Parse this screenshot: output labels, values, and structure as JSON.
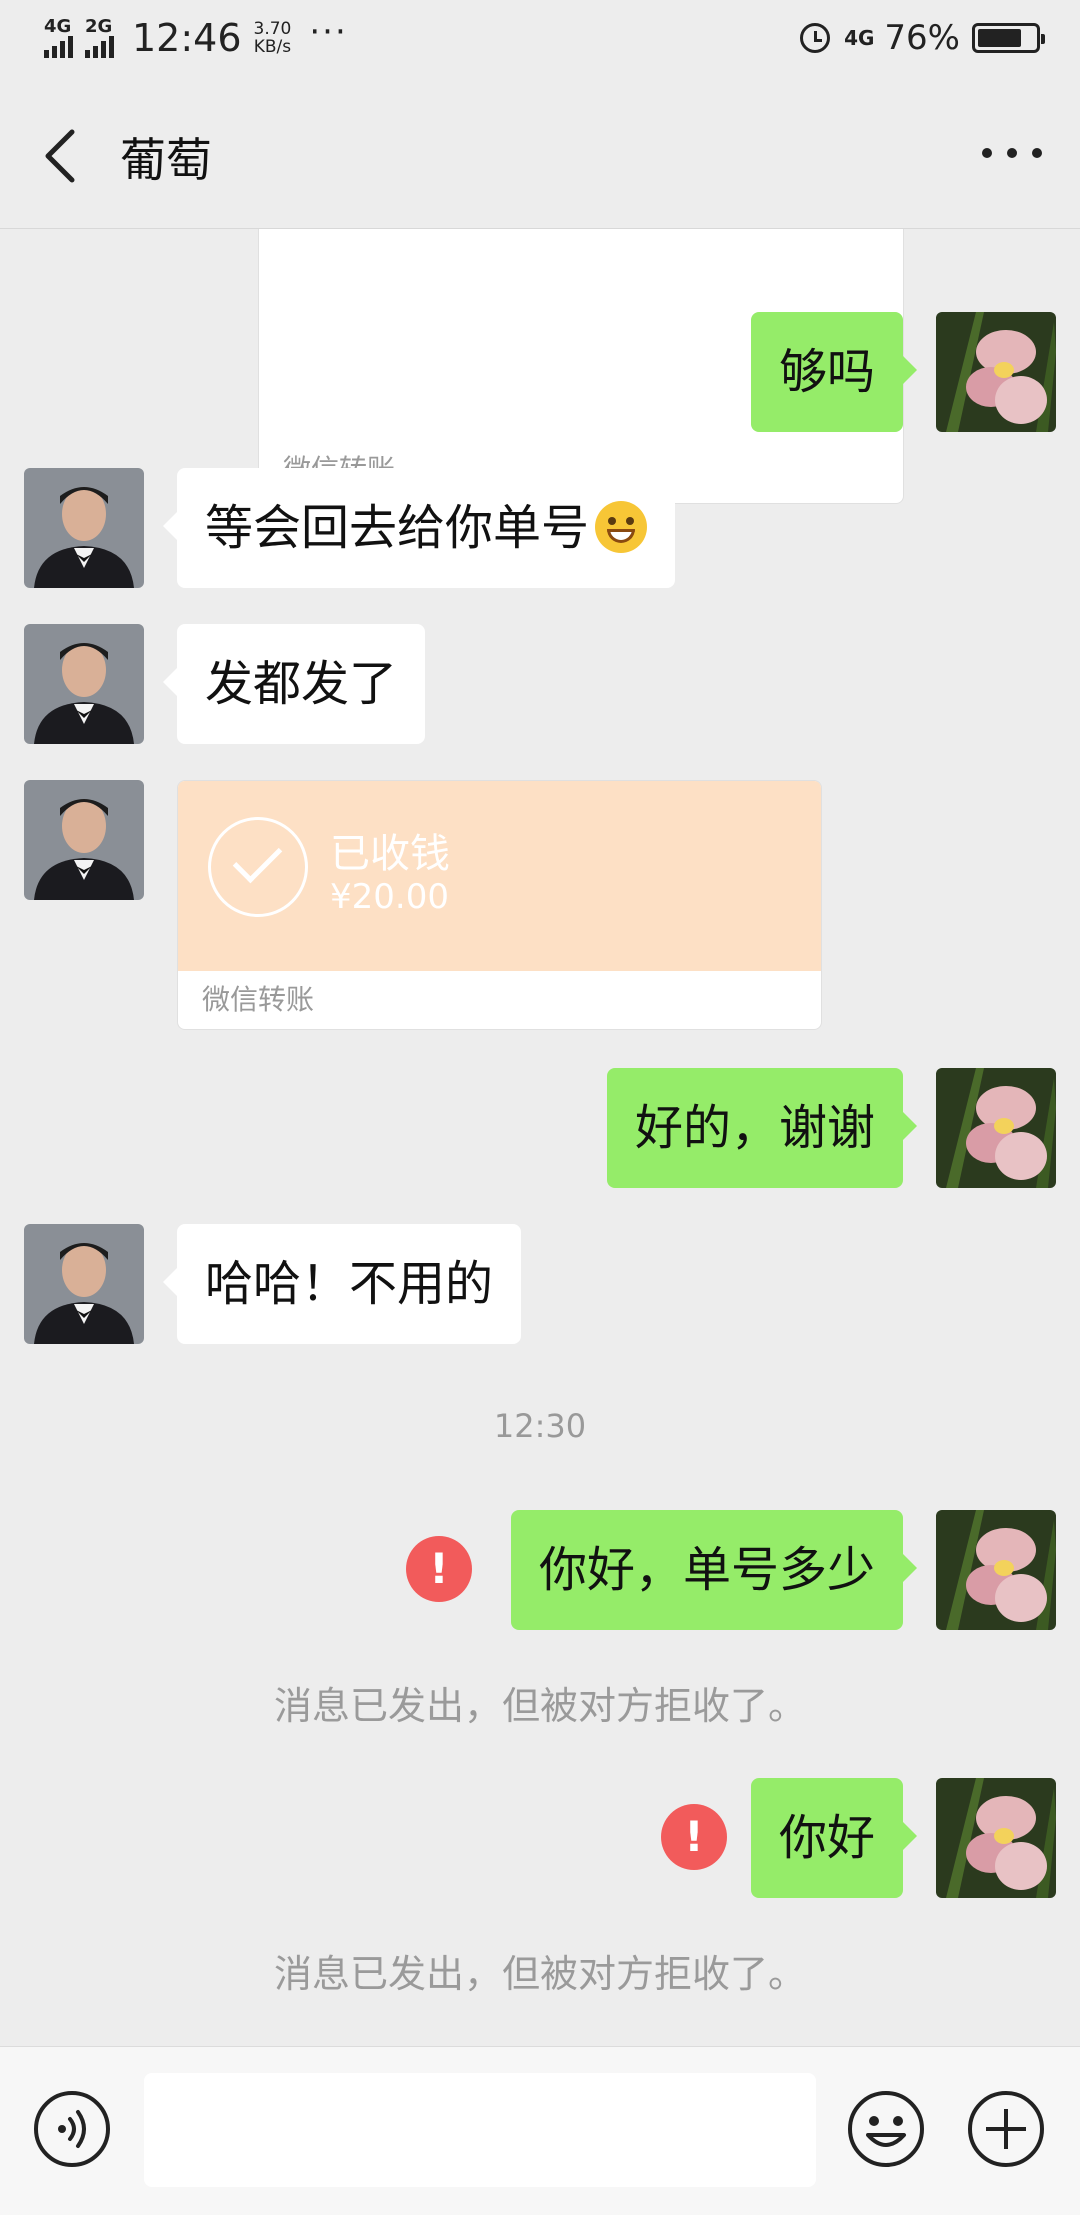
{
  "status_bar": {
    "signal1": "4G",
    "signal2": "2G",
    "time": "12:46",
    "net_speed_value": "3.70",
    "net_speed_unit": "KB/s",
    "dots": "···",
    "network": "4G",
    "battery": "76%",
    "battery_level": 0.76
  },
  "header": {
    "title": "葡萄"
  },
  "messages": [
    {
      "type": "transfer_footer_partial",
      "footer": "微信转账"
    },
    {
      "type": "text",
      "side": "right",
      "text": "够吗"
    },
    {
      "type": "text",
      "side": "left",
      "text": "等会回去给你单号",
      "emoji": "grin-emoji"
    },
    {
      "type": "text",
      "side": "left",
      "text": "发都发了"
    },
    {
      "type": "transfer",
      "side": "left",
      "title": "已收钱",
      "amount": "¥20.00",
      "footer": "微信转账"
    },
    {
      "type": "text",
      "side": "right",
      "text": "好的，谢谢"
    },
    {
      "type": "text",
      "side": "left",
      "text": "哈哈！不用的"
    },
    {
      "type": "time",
      "text": "12:30"
    },
    {
      "type": "text",
      "side": "right",
      "text": "你好，单号多少",
      "error": true
    },
    {
      "type": "system",
      "text": "消息已发出，但被对方拒收了。"
    },
    {
      "type": "text",
      "side": "right",
      "text": "你好",
      "error": true
    },
    {
      "type": "system",
      "text": "消息已发出，但被对方拒收了。"
    }
  ],
  "input": {
    "placeholder": ""
  },
  "colors": {
    "background": "#ededed",
    "bubble_green": "#95ec69",
    "bubble_white": "#ffffff",
    "transfer_orange": "#fde0c5",
    "error_red": "#f25b5b"
  }
}
